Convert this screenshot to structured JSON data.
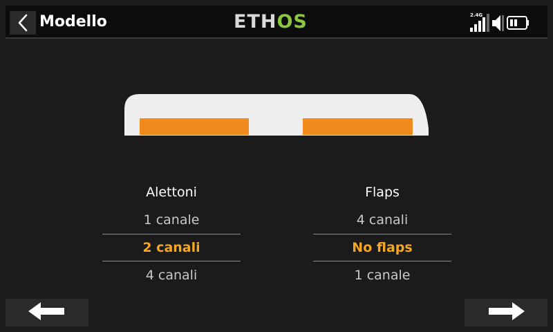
{
  "header": {
    "title": "Modello",
    "logo_text_a": "ETH",
    "logo_text_b": "OS",
    "signal_label": "2.4G",
    "icons": [
      "back-chevron-icon",
      "signal-bars-icon",
      "speaker-muted-icon",
      "battery-icon"
    ]
  },
  "colors": {
    "accent": "#f5a623",
    "flap_orange": "#f08a1c",
    "logo_green": "#8cc63f",
    "background": "#1b1b1b"
  },
  "ailerons": {
    "title": "Alettoni",
    "options": [
      "1 canale",
      "2 canali",
      "4 canali"
    ],
    "selected_index": 1
  },
  "flaps": {
    "title": "Flaps",
    "options": [
      "4 canali",
      "No flaps",
      "1 canale"
    ],
    "selected_index": 1
  },
  "nav": {
    "prev_icon": "arrow-left-icon",
    "next_icon": "arrow-right-icon"
  }
}
